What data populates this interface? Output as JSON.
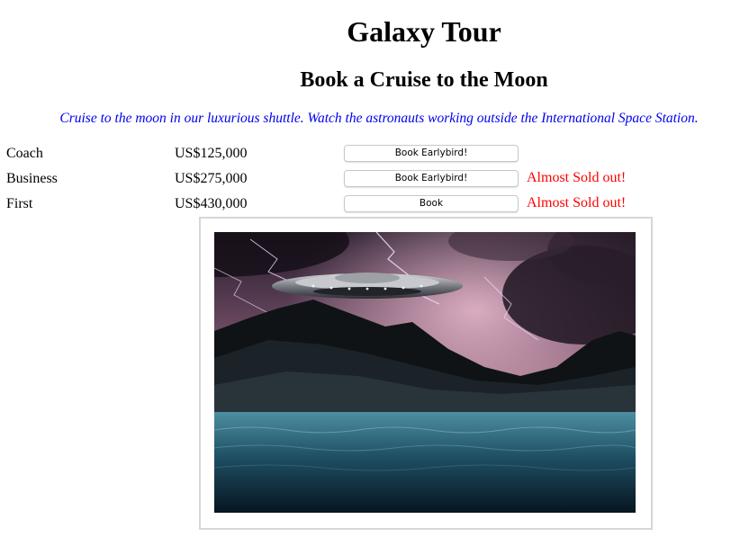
{
  "header": {
    "title": "Galaxy Tour",
    "subtitle": "Book a Cruise to the Moon",
    "tagline": "Cruise to the moon in our luxurious shuttle. Watch the astronauts working outside the International Space Station."
  },
  "fares": [
    {
      "class": "Coach",
      "price": "US$125,000",
      "button": "Book Earlybird!",
      "status": ""
    },
    {
      "class": "Business",
      "price": "US$275,000",
      "button": "Book Earlybird!",
      "status": "Almost Sold out!"
    },
    {
      "class": "First",
      "price": "US$430,000",
      "button": "Book",
      "status": "Almost Sold out!"
    }
  ],
  "colors": {
    "tagline": "#0000ee",
    "status": "#ff0000"
  },
  "image": {
    "subject": "ufo-over-stormy-lake"
  }
}
